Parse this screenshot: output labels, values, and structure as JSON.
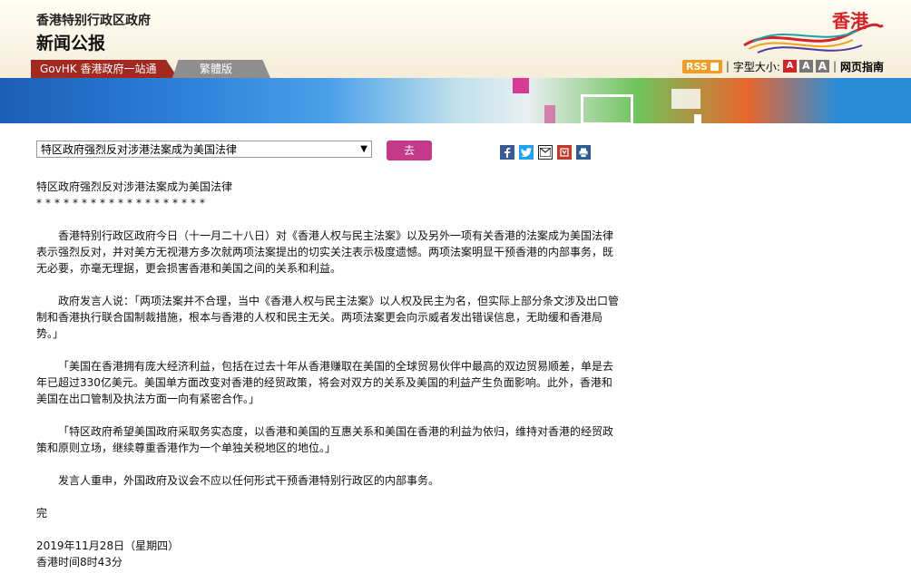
{
  "header": {
    "gov_name": "香港特别行政区政府",
    "site_title": "新闻公报",
    "logo_text": "香港"
  },
  "nav": {
    "govhk_tab": "GovHK 香港政府一站通",
    "traditional_tab": "繁體版"
  },
  "tools": {
    "rss_label": "RSS",
    "font_size_label": "字型大小:",
    "font_small": "A",
    "font_medium": "A",
    "font_large": "A",
    "sitemap_label": "网页指南"
  },
  "selector": {
    "selected": "特区政府强烈反对涉港法案成为美国法律",
    "go_label": "去"
  },
  "share": {
    "icons": [
      "facebook-icon",
      "twitter-icon",
      "email-icon",
      "bookmark-icon",
      "print-icon"
    ]
  },
  "article": {
    "headline": "特区政府强烈反对涉港法案成为美国法律",
    "stars": "*******************",
    "paragraphs": [
      "香港特别行政区政府今日（十一月二十八日）对《香港人权与民主法案》以及另外一项有关香港的法案成为美国法律表示强烈反对，并对美方无视港方多次就两项法案提出的切实关注表示极度遗憾。两项法案明显干预香港的内部事务，既无必要，亦毫无理据，更会损害香港和美国之间的关系和利益。",
      "政府发言人说：「两项法案并不合理，当中《香港人权与民主法案》以人权及民主为名，但实际上部分条文涉及出口管制和香港执行联合国制裁措施，根本与香港的人权和民主无关。两项法案更会向示威者发出错误信息，无助缓和香港局势。」",
      "「美国在香港拥有庞大经济利益，包括在过去十年从香港赚取在美国的全球贸易伙伴中最高的双边贸易顺差，单是去年已超过330亿美元。美国单方面改变对香港的经贸政策，将会对双方的关系及美国的利益产生负面影响。此外，香港和美国在出口管制及执法方面一向有紧密合作。」",
      "「特区政府希望美国政府采取务实态度，以香港和美国的互惠关系和美国在香港的利益为依归，维持对香港的经贸政策和原则立场，继续尊重香港作为一个单独关税地区的地位。」",
      "发言人重申，外国政府及议会不应以任何形式干预香港特别行政区的内部事务。"
    ],
    "end_mark": "完",
    "date": "2019年11月28日（星期四）",
    "time": "香港时间8时43分"
  }
}
